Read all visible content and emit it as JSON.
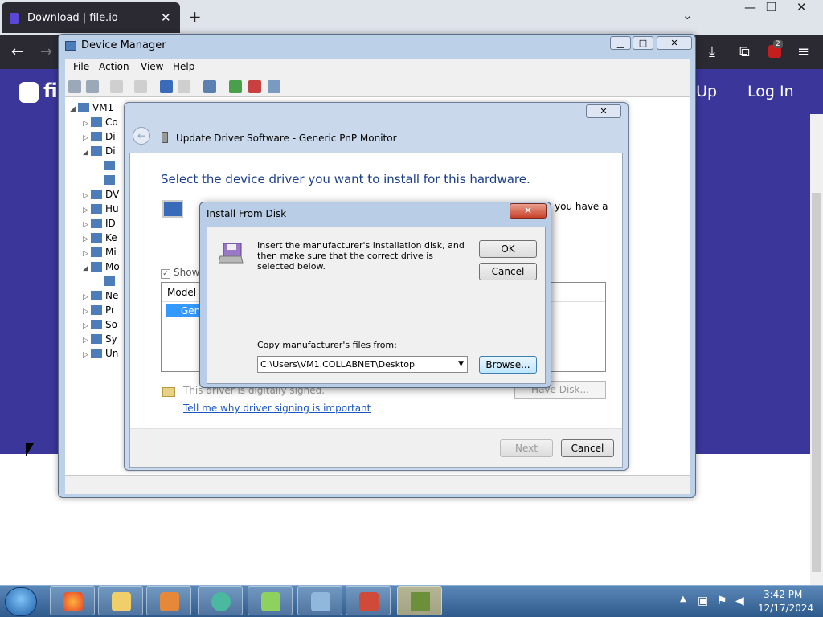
{
  "browser": {
    "tab_title": "Download | file.io",
    "tab_close": "✕",
    "new_tab": "+",
    "list_tabs": "⌄",
    "win_min": "—",
    "win_restore": "❐",
    "win_close": "✕",
    "toolbar": {
      "back": "←",
      "forward": "→",
      "download": "⤓",
      "extensions": "⧉",
      "ublock_badge": "2",
      "menu": "≡"
    }
  },
  "site": {
    "logo_text": "fi",
    "signup": "n Up",
    "login": "Log In",
    "brand_color": "#3b3699"
  },
  "device_manager": {
    "title": "Device Manager",
    "menu": [
      "File",
      "Action",
      "View",
      "Help"
    ],
    "tree": [
      {
        "exp": "◢",
        "label": "VM1",
        "indent": 0
      },
      {
        "exp": "▷",
        "label": "Co",
        "indent": 1
      },
      {
        "exp": "▷",
        "label": "Di",
        "indent": 1
      },
      {
        "exp": "◢",
        "label": "Di",
        "indent": 1
      },
      {
        "exp": "",
        "label": "",
        "indent": 2
      },
      {
        "exp": "",
        "label": "",
        "indent": 2
      },
      {
        "exp": "▷",
        "label": "DV",
        "indent": 1
      },
      {
        "exp": "▷",
        "label": "Hu",
        "indent": 1
      },
      {
        "exp": "▷",
        "label": "ID",
        "indent": 1
      },
      {
        "exp": "▷",
        "label": "Ke",
        "indent": 1
      },
      {
        "exp": "▷",
        "label": "Mi",
        "indent": 1
      },
      {
        "exp": "◢",
        "label": "Mo",
        "indent": 1
      },
      {
        "exp": "",
        "label": "",
        "indent": 2
      },
      {
        "exp": "▷",
        "label": "Ne",
        "indent": 1
      },
      {
        "exp": "▷",
        "label": "Pr",
        "indent": 1
      },
      {
        "exp": "▷",
        "label": "So",
        "indent": 1
      },
      {
        "exp": "▷",
        "label": "Sy",
        "indent": 1
      },
      {
        "exp": "▷",
        "label": "Un",
        "indent": 1
      }
    ]
  },
  "wizard": {
    "title": "Update Driver Software - Generic PnP Monitor",
    "heading": "Select the device driver you want to install for this hardware.",
    "side_text": "you have a",
    "show_compatible": "Show",
    "model_header": "Model",
    "model_item": "Gene",
    "signed_text": "This driver is digitally signed.",
    "signing_link": "Tell me why driver signing is important",
    "have_disk": "Have Disk...",
    "next": "Next",
    "cancel": "Cancel"
  },
  "install_from_disk": {
    "title": "Install From Disk",
    "close": "✕",
    "message": "Insert the manufacturer's installation disk, and then make sure that the correct drive is selected below.",
    "ok": "OK",
    "cancel": "Cancel",
    "copy_label": "Copy manufacturer's files from:",
    "path": "C:\\Users\\VM1.COLLABNET\\Desktop",
    "browse": "Browse..."
  },
  "taskbar": {
    "time": "3:42 PM",
    "date": "12/17/2024",
    "apps": [
      "firefox",
      "explorer",
      "media-player",
      "app-green",
      "dice",
      "control-panel",
      "toolbox",
      "minecraft"
    ]
  }
}
